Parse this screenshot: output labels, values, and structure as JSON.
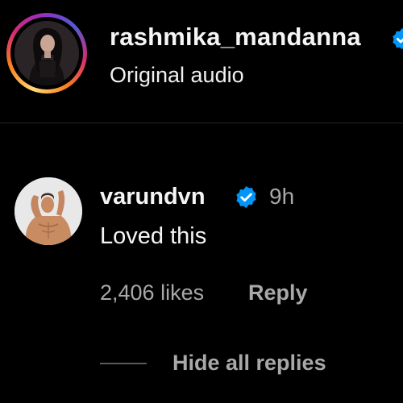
{
  "post": {
    "author": "rashmika_mandanna",
    "audio": "Original audio"
  },
  "comment": {
    "username": "varundvn",
    "time": "9h",
    "text": "Loved this",
    "likes": "2,406 likes",
    "reply_label": "Reply",
    "hide_replies_label": "Hide all replies"
  },
  "colors": {
    "background": "#000000",
    "primary_text": "#f5f5f5",
    "secondary_text": "#a8a8a8",
    "verified": "#0095f6"
  },
  "icons": {
    "verified": "verified-badge-icon"
  }
}
